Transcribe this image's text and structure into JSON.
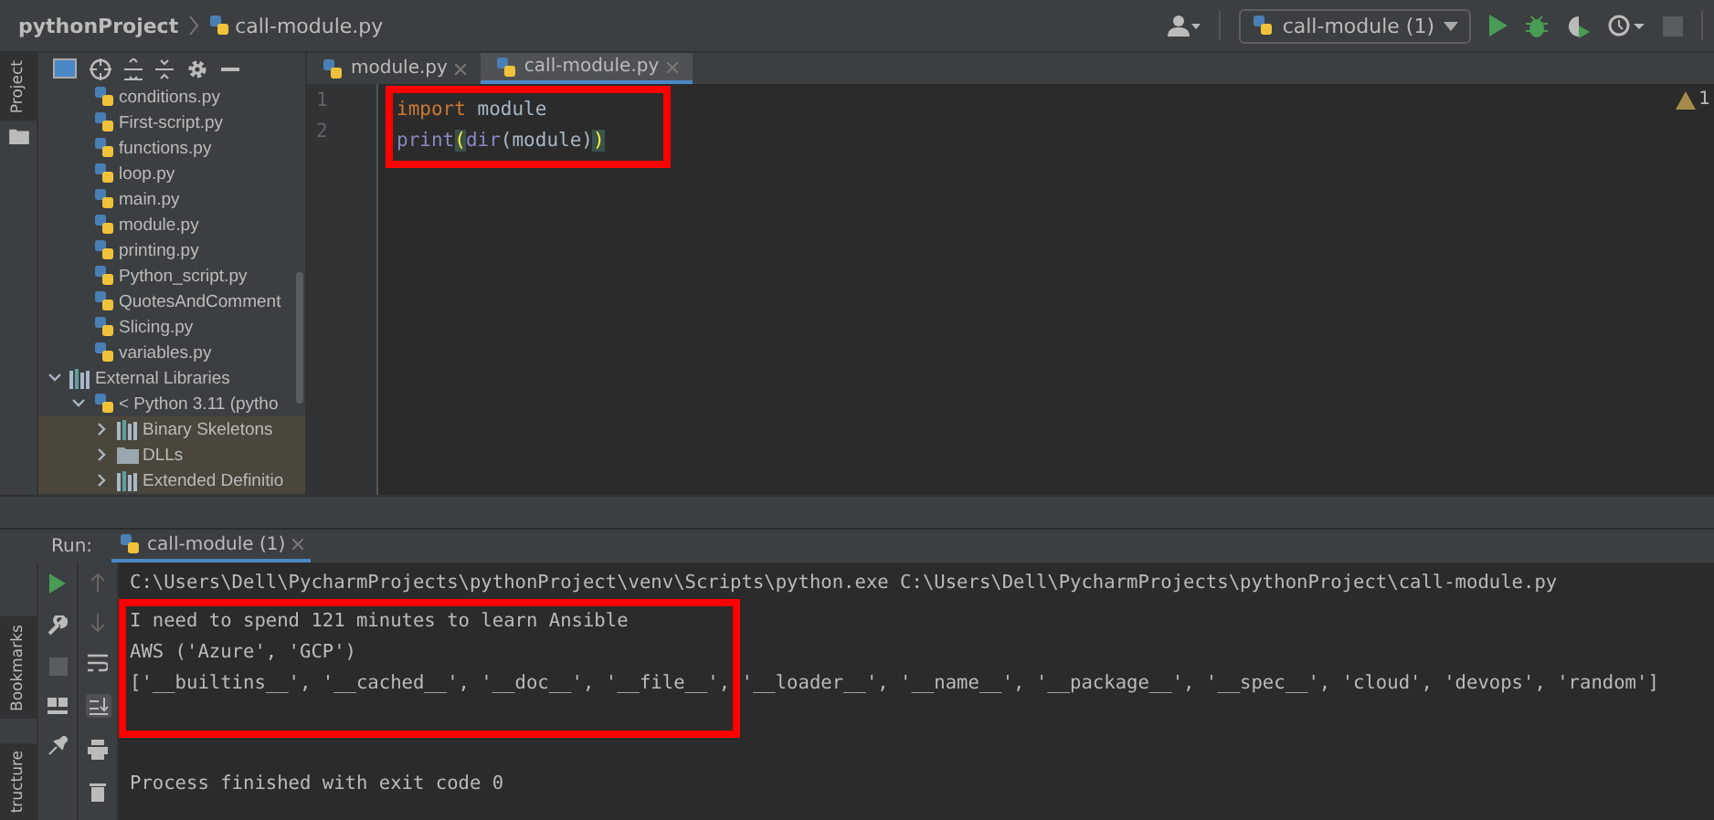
{
  "breadcrumb": {
    "project": "pythonProject",
    "file": "call-module.py"
  },
  "run_config": {
    "label": "call-module (1)"
  },
  "side_tabs": {
    "top": "Project",
    "bottom": [
      "Bookmarks",
      "tructure"
    ]
  },
  "project_tree": [
    {
      "name": "conditions.py",
      "kind": "file"
    },
    {
      "name": "First-script.py",
      "kind": "file"
    },
    {
      "name": "functions.py",
      "kind": "file"
    },
    {
      "name": "loop.py",
      "kind": "file"
    },
    {
      "name": "main.py",
      "kind": "file"
    },
    {
      "name": "module.py",
      "kind": "file"
    },
    {
      "name": "printing.py",
      "kind": "file"
    },
    {
      "name": "Python_script.py",
      "kind": "file"
    },
    {
      "name": "QuotesAndComment",
      "kind": "file"
    },
    {
      "name": "Slicing.py",
      "kind": "file"
    },
    {
      "name": "variables.py",
      "kind": "file"
    },
    {
      "name": "External Libraries",
      "kind": "library",
      "expanded": true,
      "highlighted": false,
      "children": [
        {
          "name": "< Python 3.11 (pytho",
          "kind": "python",
          "expanded": true,
          "highlighted": false,
          "children": [
            {
              "name": "Binary Skeletons",
              "kind": "library",
              "expanded": false,
              "highlighted": true
            },
            {
              "name": "DLLs",
              "kind": "folder",
              "expanded": false,
              "highlighted": true
            },
            {
              "name": "Extended Definitio",
              "kind": "library",
              "expanded": false,
              "highlighted": true
            }
          ]
        }
      ]
    }
  ],
  "editor_tabs": [
    {
      "label": "module.py",
      "selected": false
    },
    {
      "label": "call-module.py",
      "selected": true
    }
  ],
  "code": {
    "highlighted": true,
    "lines": [
      {
        "number": "1",
        "tokens": [
          {
            "text": "import",
            "kind": "keyword"
          },
          {
            "text": " module",
            "kind": "plain"
          }
        ]
      },
      {
        "number": "2",
        "tokens": [
          {
            "text": "print",
            "kind": "builtin"
          },
          {
            "text": "(",
            "kind": "brace"
          },
          {
            "text": "dir",
            "kind": "builtin"
          },
          {
            "text": "(module)",
            "kind": "plain"
          },
          {
            "text": ")",
            "kind": "brace"
          }
        ]
      }
    ]
  },
  "warnings": {
    "count": "1"
  },
  "run": {
    "label": "Run:",
    "tab": "call-module (1)",
    "output": [
      {
        "text": "C:\\Users\\Dell\\PycharmProjects\\pythonProject\\venv\\Scripts\\python.exe C:\\Users\\Dell\\PycharmProjects\\pythonProject\\call-module.py",
        "kind": "command",
        "highlighted": false
      },
      {
        "text": "I need to spend 121 minutes to learn Ansible",
        "kind": "output",
        "highlighted": true
      },
      {
        "text": "AWS ('Azure', 'GCP')",
        "kind": "output",
        "highlighted": true
      },
      {
        "text": "['__builtins__', '__cached__', '__doc__', '__file__', '__loader__', '__name__', '__package__', '__spec__', 'cloud', 'devops', 'random']",
        "kind": "output",
        "highlighted": true
      },
      {
        "text": "Process finished with exit code 0",
        "kind": "status",
        "highlighted": false
      }
    ]
  }
}
